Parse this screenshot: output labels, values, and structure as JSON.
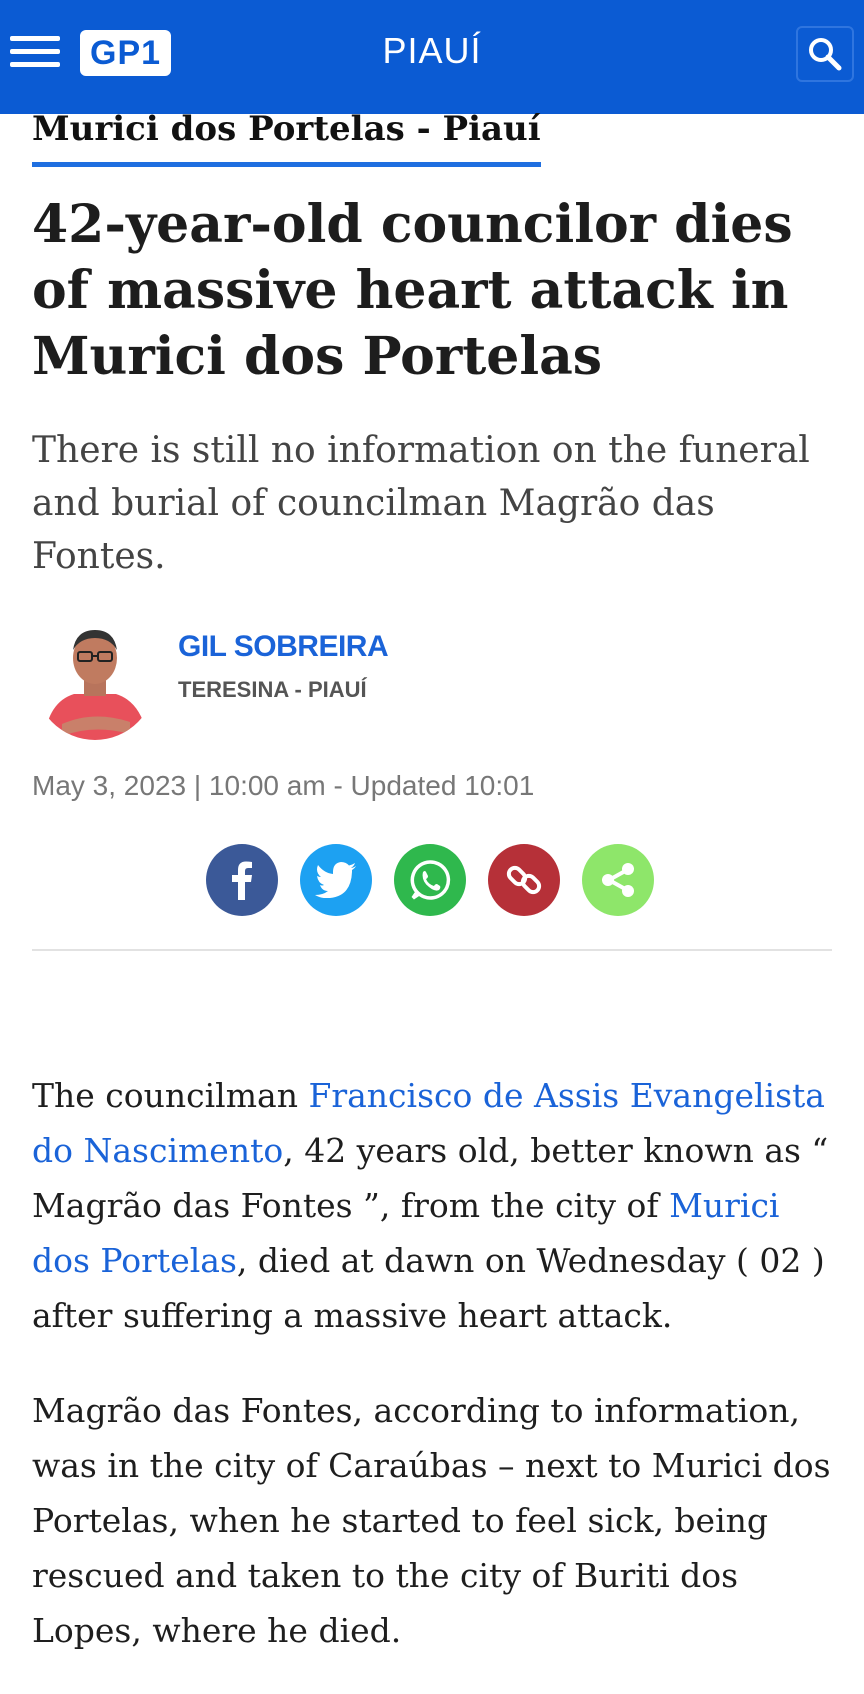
{
  "header": {
    "logo": "GP1",
    "section": "PIAUÍ",
    "colors": {
      "bar": "#0b5bd3"
    },
    "menu_icon": "hamburger-menu-icon",
    "search_icon": "search-icon"
  },
  "article": {
    "category": "Murici dos Portelas - Piauí",
    "headline": "42-year-old councilor dies of massive heart attack in Murici dos Portelas",
    "subheadline": "There is still no information on the funeral and burial of councilman Magrão das Fontes.",
    "author": {
      "name": "GIL SOBREIRA",
      "location": "TERESINA - PIAUÍ"
    },
    "date_line": "May 3, 2023 | 10:00 am - Updated 10:01",
    "share": [
      {
        "name": "facebook",
        "icon": "facebook-icon",
        "color": "#3b5998"
      },
      {
        "name": "twitter",
        "icon": "twitter-icon",
        "color": "#1da1f2"
      },
      {
        "name": "whatsapp",
        "icon": "whatsapp-icon",
        "color": "#2fb84d"
      },
      {
        "name": "copy-link",
        "icon": "link-icon",
        "color": "#b63038"
      },
      {
        "name": "share",
        "icon": "share-icon",
        "color": "#8ee66a"
      }
    ],
    "paragraph1": {
      "t1": "The councilman ",
      "link1": "Francisco de Assis Evangelista do Nascimento",
      "t2": ", 42 years old, better known as “ Magrão das Fontes ”, from the city of ",
      "link2": "Murici dos Portelas",
      "t3": ", died at dawn on Wednesday ( 02 ) after suffering a massive heart attack."
    },
    "paragraph2": "Magrão das Fontes, according to information, was in the city of Caraúbas – next to Murici dos Portelas, when he started to feel sick, being rescued and taken to the city of Buriti dos Lopes, where he died."
  }
}
